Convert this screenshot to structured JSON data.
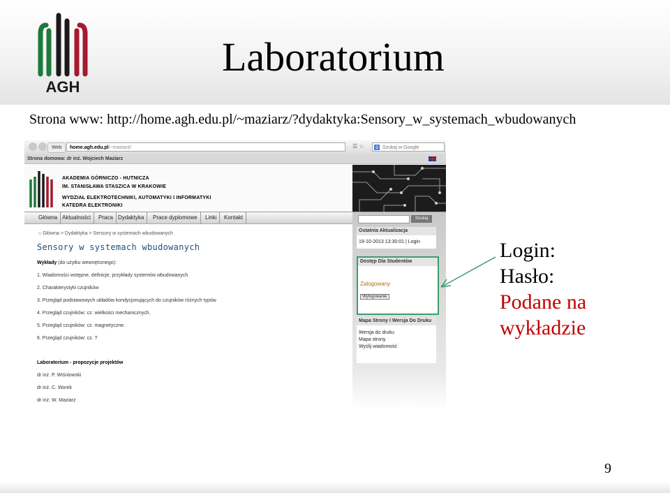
{
  "slide": {
    "title": "Laboratorium",
    "url_line": "Strona www: http://home.agh.edu.pl/~maziarz/?dydaktyka:Sensory_w_systemach_wbudowanych",
    "page_number": "9",
    "logo_text": "AGH",
    "note": {
      "login": "Login:",
      "password": "Hasło:",
      "given1": "Podane na",
      "given2": "wykładzie"
    },
    "colors": {
      "agh_green": "#1d7a3b",
      "agh_red": "#a6192e",
      "agh_black": "#1a1a1a",
      "note_red": "#c00000",
      "arrow": "#3c9c6e"
    }
  },
  "browser": {
    "web_button": "Web",
    "address_bold": "home.agh.edu.pl",
    "address_rest": "/~maziarz/",
    "search_placeholder": "Szukaj w Google",
    "site_title": "Strona domowa: dr inż. Wojciech Maziarz",
    "banner": {
      "line1": "AKADEMIA GÓRNICZO - HUTNICZA",
      "line2": "IM. STANISŁAWA STASZICA W KRAKOWIE",
      "line3": "WYDZIAŁ ELEKTROTECHNIKI, AUTOMATYKI I INFORMATYKI",
      "line4": "KATEDRA ELEKTRONIKI"
    },
    "menu": [
      "Główna",
      "Aktualności",
      "Praca",
      "Dydaktyka",
      "Prace dyplomowe",
      "Linki",
      "Kontakt"
    ],
    "sidebar": {
      "search_button": "Szukaj",
      "last_update_title": "Ostatnia Aktualizacja",
      "last_update_value": "19-10-2013 13:30:01 | Login",
      "student_title": "Dostęp Dla Studentów",
      "logged_in": "Zalogowany",
      "logout_button": "Wylogowanie",
      "sitemap_title": "Mapa Strony I Wersja Do Druku",
      "sitemap_links": [
        "Wersja do druku",
        "Mapa strony",
        "Wyślij wiadomość"
      ]
    },
    "content": {
      "breadcrumb": "Główna > Dydaktyka > Sensory w systemach wbudowanych",
      "heading": "Sensory w systemach wbudowanych",
      "lectures_label": "Wykłady",
      "lectures_note": "(do użytku wewnętrznego):",
      "lectures": [
        "1. Wiadomości wstępne, definicje, przykłady systemów wbudowanych",
        "2. Charakterystyki czujników",
        "3. Przegląd podstawowych układów kondycjonujących do czujników różnych typów",
        "4. Przegląd czujników: cz. wielkości mechanicznych.",
        "5. Przegląd czujników: cz. magnetyczne.",
        "6. Przegląd czujników: cz. ?"
      ],
      "lab_heading": "Laboratorium - propozycje projektów",
      "lab_people": [
        "dr inż. P. Wiśniowski",
        "dr inż. C. Worek",
        "dr inż. W. Maziarz"
      ]
    }
  }
}
